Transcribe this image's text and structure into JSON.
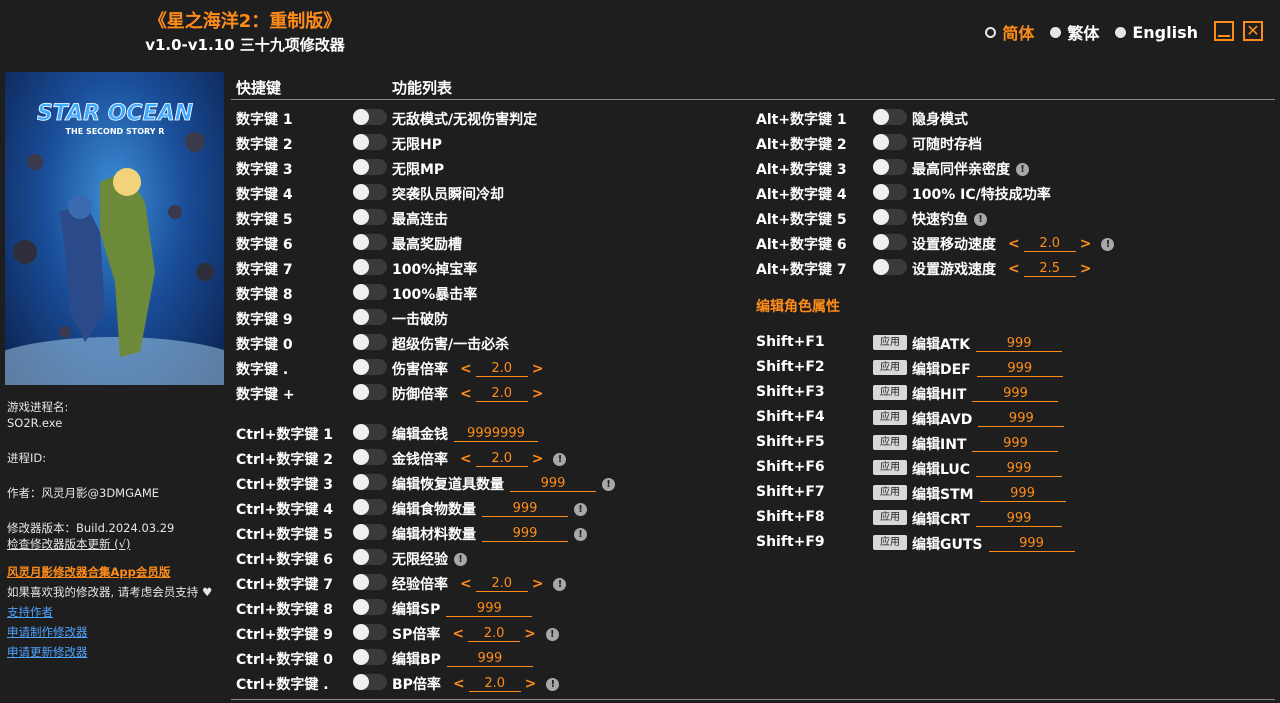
{
  "title": {
    "main": "《星之海洋2：重制版》",
    "sub": "v1.0-v1.10 三十九项修改器"
  },
  "lang": {
    "options": [
      "简体",
      "繁体",
      "English"
    ],
    "selected": 0
  },
  "window": {
    "minimize_icon": "minimize-icon",
    "close_icon": "close-icon",
    "close_glyph": "✕"
  },
  "cover": {
    "logo_line1": "STAR OCEAN",
    "logo_line2": "THE SECOND STORY R"
  },
  "sidebar": {
    "process_name_label": "游戏进程名:",
    "process_name": "SO2R.exe",
    "process_id_label": "进程ID:",
    "author": "作者：风灵月影@3DMGAME",
    "version": "修改器版本：Build.2024.03.29",
    "check_update": "检查修改器版本更新 (√)",
    "app_promo": "风灵月影修改器合集App会员版",
    "support_text": "如果喜欢我的修改器, 请考虑会员支持 ♥",
    "links": [
      "支持作者",
      "申请制作修改器",
      "申请更新修改器"
    ]
  },
  "headers": {
    "hotkey": "快捷键",
    "function": "功能列表"
  },
  "colors": {
    "accent": "#ff8c1a",
    "bg": "#1e1e1e",
    "link": "#4da3ff"
  },
  "left_rows": [
    {
      "key": "数字键 1",
      "label": "无敌模式/无视伤害判定"
    },
    {
      "key": "数字键 2",
      "label": "无限HP"
    },
    {
      "key": "数字键 3",
      "label": "无限MP"
    },
    {
      "key": "数字键 4",
      "label": "突袭队员瞬间冷却"
    },
    {
      "key": "数字键 5",
      "label": "最高连击"
    },
    {
      "key": "数字键 6",
      "label": "最高奖励槽"
    },
    {
      "key": "数字键 7",
      "label": "100%掉宝率"
    },
    {
      "key": "数字键 8",
      "label": "100%暴击率"
    },
    {
      "key": "数字键 9",
      "label": "一击破防"
    },
    {
      "key": "数字键 0",
      "label": "超级伤害/一击必杀"
    },
    {
      "key": "数字键 .",
      "label": "伤害倍率",
      "stepper": "2.0"
    },
    {
      "key": "数字键 +",
      "label": "防御倍率",
      "stepper": "2.0"
    },
    {
      "key": "Ctrl+数字键 1",
      "label": "编辑金钱",
      "input": "9999999"
    },
    {
      "key": "Ctrl+数字键 2",
      "label": "金钱倍率",
      "stepper": "2.0",
      "warn": true
    },
    {
      "key": "Ctrl+数字键 3",
      "label": "编辑恢复道具数量",
      "input": "999",
      "warn": true
    },
    {
      "key": "Ctrl+数字键 4",
      "label": "编辑食物数量",
      "input": "999",
      "warn": true
    },
    {
      "key": "Ctrl+数字键 5",
      "label": "编辑材料数量",
      "input": "999",
      "warn": true
    },
    {
      "key": "Ctrl+数字键 6",
      "label": "无限经验",
      "warn": true
    },
    {
      "key": "Ctrl+数字键 7",
      "label": "经验倍率",
      "stepper": "2.0",
      "warn": true
    },
    {
      "key": "Ctrl+数字键 8",
      "label": "编辑SP",
      "input": "999"
    },
    {
      "key": "Ctrl+数字键 9",
      "label": "SP倍率",
      "stepper": "2.0",
      "warn": true
    },
    {
      "key": "Ctrl+数字键 0",
      "label": "编辑BP",
      "input": "999"
    },
    {
      "key": "Ctrl+数字键 .",
      "label": "BP倍率",
      "stepper": "2.0",
      "warn": true
    }
  ],
  "right_rows": [
    {
      "key": "Alt+数字键 1",
      "label": "隐身模式"
    },
    {
      "key": "Alt+数字键 2",
      "label": "可随时存档"
    },
    {
      "key": "Alt+数字键 3",
      "label": "最高同伴亲密度",
      "warn": true
    },
    {
      "key": "Alt+数字键 4",
      "label": "100% IC/特技成功率"
    },
    {
      "key": "Alt+数字键 5",
      "label": "快速钓鱼",
      "warn": true
    },
    {
      "key": "Alt+数字键 6",
      "label": "设置移动速度",
      "stepper": "2.0",
      "warn": true
    },
    {
      "key": "Alt+数字键 7",
      "label": "设置游戏速度",
      "stepper": "2.5"
    }
  ],
  "attr_section_title": "编辑角色属性",
  "apply_label": "应用",
  "attr_rows": [
    {
      "key": "Shift+F1",
      "label": "编辑ATK",
      "input": "999"
    },
    {
      "key": "Shift+F2",
      "label": "编辑DEF",
      "input": "999"
    },
    {
      "key": "Shift+F3",
      "label": "编辑HIT",
      "input": "999"
    },
    {
      "key": "Shift+F4",
      "label": "编辑AVD",
      "input": "999"
    },
    {
      "key": "Shift+F5",
      "label": "编辑INT",
      "input": "999"
    },
    {
      "key": "Shift+F6",
      "label": "编辑LUC",
      "input": "999"
    },
    {
      "key": "Shift+F7",
      "label": "编辑STM",
      "input": "999"
    },
    {
      "key": "Shift+F8",
      "label": "编辑CRT",
      "input": "999"
    },
    {
      "key": "Shift+F9",
      "label": "编辑GUTS",
      "input": "999"
    }
  ]
}
